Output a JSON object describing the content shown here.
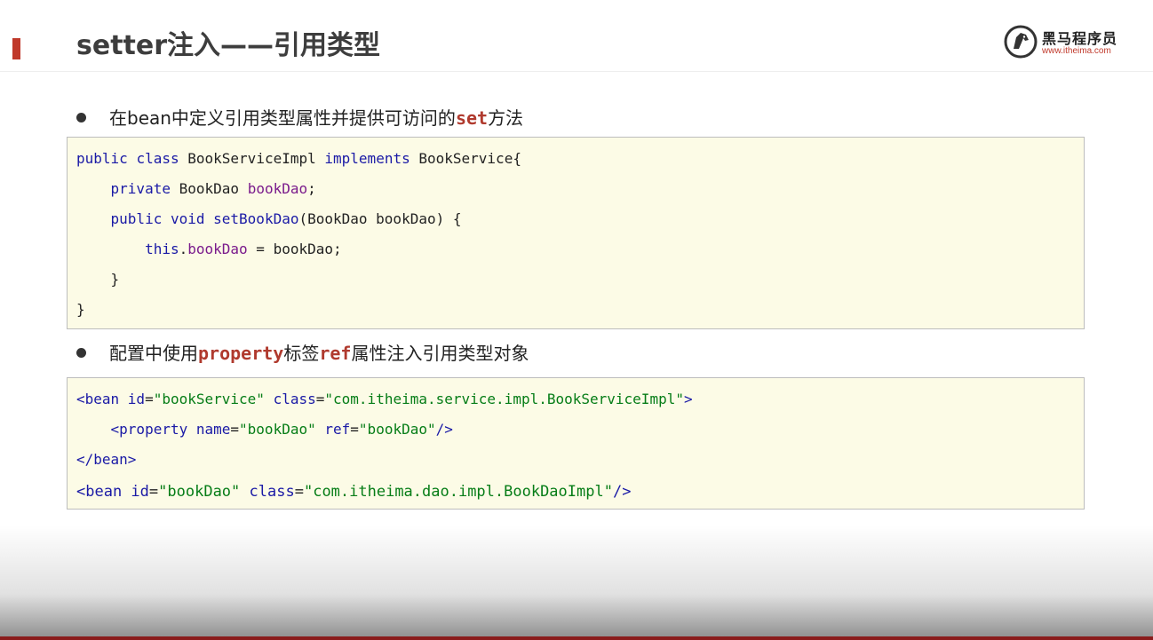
{
  "slide": {
    "title": "setter注入——引用类型",
    "accent_color": "#c0392b"
  },
  "logo": {
    "name": "黑马程序员",
    "url": "www.itheima.com",
    "icon": "horse-head-icon"
  },
  "bullets": [
    {
      "text_before": "在bean中定义引用类型属性并提供可访问的",
      "keyword": "set",
      "text_after": "方法"
    },
    {
      "text_before": "配置中使用",
      "keyword1": "property",
      "text_mid": "标签",
      "keyword2": "ref",
      "text_after": "属性注入引用类型对象"
    }
  ],
  "java_code": {
    "l1": {
      "kw1": "public",
      "kw2": "class",
      "name": "BookServiceImpl",
      "kw3": "implements",
      "iface": "BookService{"
    },
    "l2": {
      "kw": "private",
      "type": "BookDao",
      "field": "bookDao",
      "end": ";"
    },
    "l3": {
      "kw1": "public",
      "kw2": "void",
      "method": "setBookDao",
      "params": "(BookDao bookDao) {"
    },
    "l4": {
      "kw": "this",
      "dot": ".",
      "field": "bookDao",
      "rest": " = bookDao;"
    },
    "l5": "}",
    "l6": "}"
  },
  "xml_code": {
    "l1": {
      "open": "<bean ",
      "attr1": "id",
      "val1": "\"bookService\"",
      "attr2": "class",
      "val2": "\"com.itheima.service.impl.BookServiceImpl\"",
      "close": ">"
    },
    "l2": {
      "open": "<property ",
      "attr1": "name",
      "val1": "\"bookDao\"",
      "attr2": "ref",
      "val2": "\"bookDao\"",
      "close": "/>"
    },
    "l3": "</bean>",
    "l4": {
      "open": "<bean ",
      "attr1": "id",
      "val1": "\"bookDao\"",
      "attr2": "class",
      "val2": "\"com.itheima.dao.impl.BookDaoImpl\"",
      "close": "/>"
    }
  }
}
